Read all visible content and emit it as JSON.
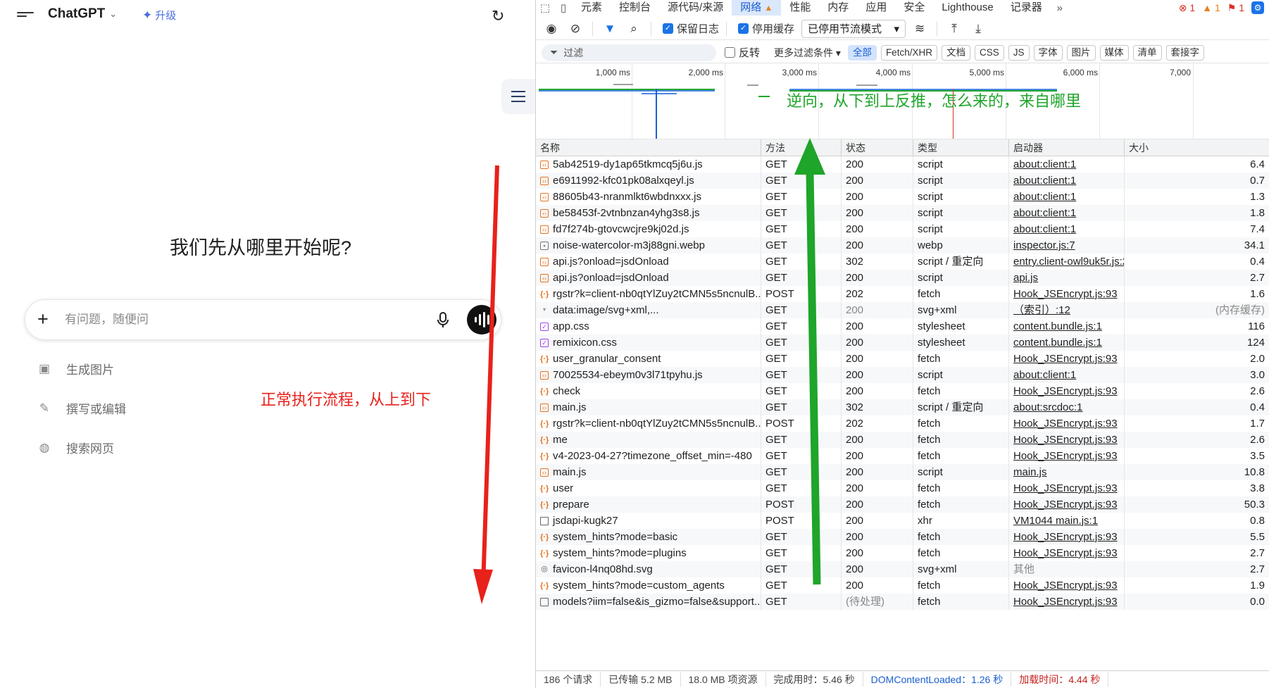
{
  "chatgpt": {
    "brand": "ChatGPT",
    "upgrade": "升级",
    "heading": "我们先从哪里开始呢?",
    "input_placeholder": "有问题，随便问",
    "suggestions": [
      {
        "label": "生成图片",
        "icon": "image-icon"
      },
      {
        "label": "撰写或编辑",
        "icon": "pencil-icon"
      },
      {
        "label": "搜索网页",
        "icon": "globe-icon"
      }
    ],
    "annotation_red": "正常执行流程，从上到下"
  },
  "devtools": {
    "tabs": [
      "元素",
      "控制台",
      "源代码/来源",
      "网络",
      "性能",
      "内存",
      "应用",
      "安全",
      "Lighthouse",
      "记录器"
    ],
    "active_tab": "网络",
    "counts": {
      "errors": "1",
      "warnings": "1",
      "issues": "1"
    },
    "toolbar": {
      "preserve_log": "保留日志",
      "disable_cache": "停用缓存",
      "throttle": "已停用节流模式"
    },
    "filter": {
      "placeholder": "过滤",
      "invert": "反转",
      "more": "更多过滤条件",
      "chips": [
        "全部",
        "Fetch/XHR",
        "文档",
        "CSS",
        "JS",
        "字体",
        "图片",
        "媒体",
        "清单",
        "套接字"
      ]
    },
    "timeline_labels": [
      "1,000 ms",
      "2,000 ms",
      "3,000 ms",
      "4,000 ms",
      "5,000 ms",
      "6,000 ms",
      "7,000"
    ],
    "annotation_green": "逆向，从下到上反推，怎么来的，来自哪里",
    "columns": [
      "名称",
      "方法",
      "状态",
      "类型",
      "启动器",
      "大小"
    ],
    "rows": [
      {
        "name": "5ab42519-dy1ap65tkmcq5j6u.js",
        "method": "GET",
        "status": "200",
        "type": "script",
        "initiator": "about:client:1",
        "size": "6.4",
        "icon": "script"
      },
      {
        "name": "e6911992-kfc01pk08alxqeyl.js",
        "method": "GET",
        "status": "200",
        "type": "script",
        "initiator": "about:client:1",
        "size": "0.7",
        "icon": "script"
      },
      {
        "name": "88605b43-nranmlkt6wbdnxxx.js",
        "method": "GET",
        "status": "200",
        "type": "script",
        "initiator": "about:client:1",
        "size": "1.3",
        "icon": "script"
      },
      {
        "name": "be58453f-2vtnbnzan4yhg3s8.js",
        "method": "GET",
        "status": "200",
        "type": "script",
        "initiator": "about:client:1",
        "size": "1.8",
        "icon": "script"
      },
      {
        "name": "fd7f274b-gtovcwcjre9kj02d.js",
        "method": "GET",
        "status": "200",
        "type": "script",
        "initiator": "about:client:1",
        "size": "7.4",
        "icon": "script"
      },
      {
        "name": "noise-watercolor-m3j88gni.webp",
        "method": "GET",
        "status": "200",
        "type": "webp",
        "initiator": "inspector.js:7",
        "size": "34.1",
        "icon": "img"
      },
      {
        "name": "api.js?onload=jsdOnload",
        "method": "GET",
        "status": "302",
        "type": "script / 重定向",
        "initiator": "entry.client-owl9uk5r.js:2",
        "size": "0.4",
        "icon": "script"
      },
      {
        "name": "api.js?onload=jsdOnload",
        "method": "GET",
        "status": "200",
        "type": "script",
        "initiator": "api.js",
        "size": "2.7",
        "icon": "script"
      },
      {
        "name": "rgstr?k=client-nb0qtYlZuy2tCMN5s5ncnulB...",
        "method": "POST",
        "status": "202",
        "type": "fetch",
        "initiator": "Hook_JSEncrypt.js:93",
        "size": "1.6",
        "icon": "fetch"
      },
      {
        "name": "data:image/svg+xml,...",
        "method": "GET",
        "status": "200",
        "type": "svg+xml",
        "initiator": "（索引）:12",
        "size": "(内存缓存)",
        "icon": "data"
      },
      {
        "name": "app.css",
        "method": "GET",
        "status": "200",
        "type": "stylesheet",
        "initiator": "content.bundle.js:1",
        "size": "116",
        "icon": "css"
      },
      {
        "name": "remixicon.css",
        "method": "GET",
        "status": "200",
        "type": "stylesheet",
        "initiator": "content.bundle.js:1",
        "size": "124",
        "icon": "css"
      },
      {
        "name": "user_granular_consent",
        "method": "GET",
        "status": "200",
        "type": "fetch",
        "initiator": "Hook_JSEncrypt.js:93",
        "size": "2.0",
        "icon": "fetch"
      },
      {
        "name": "70025534-ebeym0v3l71tpyhu.js",
        "method": "GET",
        "status": "200",
        "type": "script",
        "initiator": "about:client:1",
        "size": "3.0",
        "icon": "script"
      },
      {
        "name": "check",
        "method": "GET",
        "status": "200",
        "type": "fetch",
        "initiator": "Hook_JSEncrypt.js:93",
        "size": "2.6",
        "icon": "fetch"
      },
      {
        "name": "main.js",
        "method": "GET",
        "status": "302",
        "type": "script / 重定向",
        "initiator": "about:srcdoc:1",
        "size": "0.4",
        "icon": "script"
      },
      {
        "name": "rgstr?k=client-nb0qtYlZuy2tCMN5s5ncnulB...",
        "method": "POST",
        "status": "202",
        "type": "fetch",
        "initiator": "Hook_JSEncrypt.js:93",
        "size": "1.7",
        "icon": "fetch"
      },
      {
        "name": "me",
        "method": "GET",
        "status": "200",
        "type": "fetch",
        "initiator": "Hook_JSEncrypt.js:93",
        "size": "2.6",
        "icon": "fetch"
      },
      {
        "name": "v4-2023-04-27?timezone_offset_min=-480",
        "method": "GET",
        "status": "200",
        "type": "fetch",
        "initiator": "Hook_JSEncrypt.js:93",
        "size": "3.5",
        "icon": "fetch"
      },
      {
        "name": "main.js",
        "method": "GET",
        "status": "200",
        "type": "script",
        "initiator": "main.js",
        "size": "10.8",
        "icon": "script"
      },
      {
        "name": "user",
        "method": "GET",
        "status": "200",
        "type": "fetch",
        "initiator": "Hook_JSEncrypt.js:93",
        "size": "3.8",
        "icon": "fetch"
      },
      {
        "name": "prepare",
        "method": "POST",
        "status": "200",
        "type": "fetch",
        "initiator": "Hook_JSEncrypt.js:93",
        "size": "50.3",
        "icon": "fetch"
      },
      {
        "name": "jsdapi-kugk27",
        "method": "POST",
        "status": "200",
        "type": "xhr",
        "initiator": "VM1044 main.js:1",
        "size": "0.8",
        "icon": "doc"
      },
      {
        "name": "system_hints?mode=basic",
        "method": "GET",
        "status": "200",
        "type": "fetch",
        "initiator": "Hook_JSEncrypt.js:93",
        "size": "5.5",
        "icon": "fetch"
      },
      {
        "name": "system_hints?mode=plugins",
        "method": "GET",
        "status": "200",
        "type": "fetch",
        "initiator": "Hook_JSEncrypt.js:93",
        "size": "2.7",
        "icon": "fetch"
      },
      {
        "name": "favicon-l4nq08hd.svg",
        "method": "GET",
        "status": "200",
        "type": "svg+xml",
        "initiator": "其他",
        "size": "2.7",
        "icon": "svg"
      },
      {
        "name": "system_hints?mode=custom_agents",
        "method": "GET",
        "status": "200",
        "type": "fetch",
        "initiator": "Hook_JSEncrypt.js:93",
        "size": "1.9",
        "icon": "fetch"
      },
      {
        "name": "models?iim=false&is_gizmo=false&support...",
        "method": "GET",
        "status": "(待处理)",
        "type": "fetch",
        "initiator": "Hook_JSEncrypt.js:93",
        "size": "0.0",
        "icon": "doc"
      }
    ],
    "status_bar": {
      "requests": "186 个请求",
      "transferred": "已传输 5.2 MB",
      "resources": "18.0 MB 项资源",
      "finish": "完成用时：5.46 秒",
      "dcl": "DOMContentLoaded：1.26 秒",
      "load": "加载时间：4.44 秒"
    }
  }
}
